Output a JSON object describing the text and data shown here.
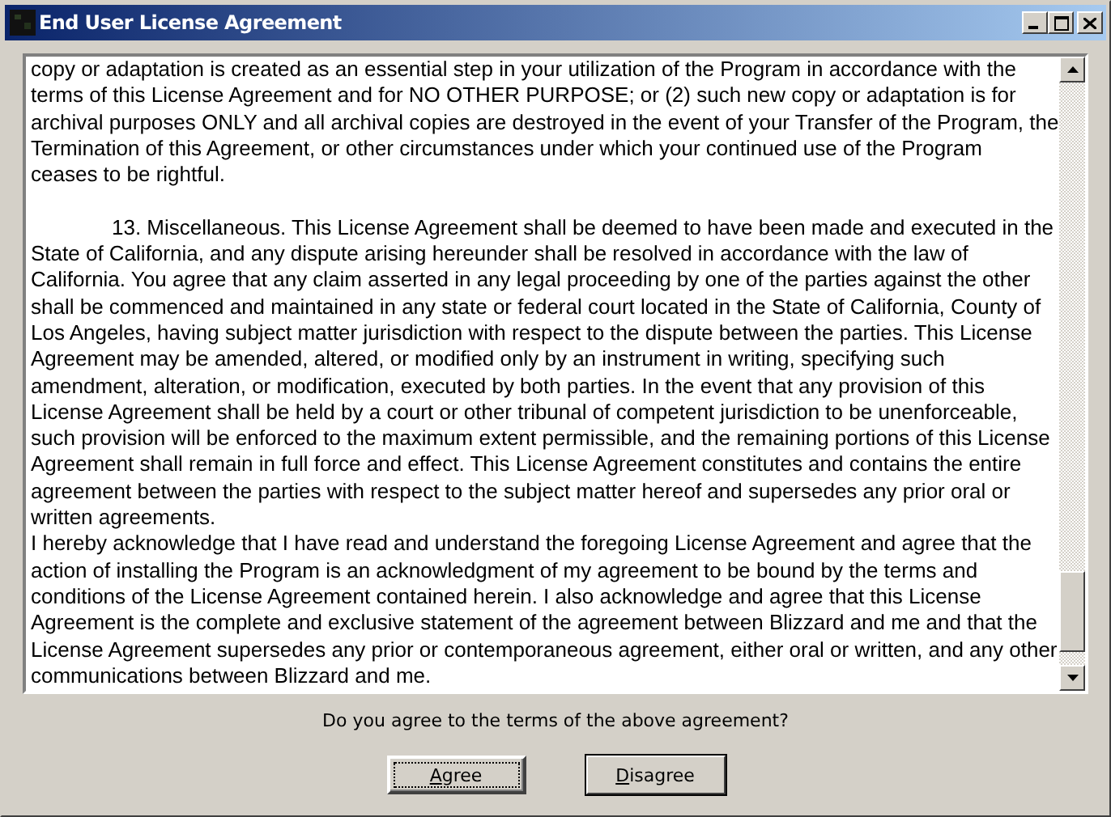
{
  "window": {
    "title": "End User License Agreement"
  },
  "license_text": {
    "paragraphs": [
      {
        "indented": false,
        "text": "copy or adaptation is created as an essential step in your utilization of the Program in accordance with the\nterms of this License Agreement and for NO OTHER PURPOSE; or (2) such new copy or adaptation is for\narchival purposes ONLY and all archival copies are destroyed in the event of your Transfer of the Program, the\nTermination of this Agreement, or other circumstances under which your continued use of the Program\nceases to be rightful."
      },
      {
        "indented": true,
        "text": "13. Miscellaneous. This License Agreement shall be deemed to have been made and executed in the\nState of California, and any dispute arising hereunder shall be resolved in accordance with the law of\nCalifornia. You agree that any claim asserted in any legal proceeding by one of the parties against the other\nshall be commenced and maintained in any state or federal court located in the State of California, County of\nLos Angeles, having subject matter jurisdiction with respect to the dispute between the parties. This License\nAgreement may be amended, altered, or modified only by an instrument in writing, specifying such\namendment, alteration, or modification, executed by both parties. In the event that any provision of this\nLicense Agreement shall be held by a court or other tribunal of competent jurisdiction to be unenforceable,\nsuch provision will be enforced to the maximum extent permissible, and the remaining portions of this License\nAgreement shall remain in full force and effect. This License Agreement constitutes and contains the entire\nagreement between the parties with respect to the subject matter hereof and supersedes any prior oral or\nwritten agreements."
      },
      {
        "indented": false,
        "text": "I hereby acknowledge that I have read and understand the foregoing License Agreement and agree that the\naction of installing the Program is an acknowledgment of my agreement to be bound by the terms and\nconditions of the License Agreement contained herein. I also acknowledge and agree that this License\nAgreement is the complete and exclusive statement of the agreement between Blizzard and me and that the\nLicense Agreement supersedes any prior or contemporaneous agreement, either oral or written, and any other\ncommunications between Blizzard and me."
      }
    ]
  },
  "question": "Do you agree to the terms of the above agreement?",
  "buttons": [
    {
      "label": "Agree",
      "focused": true
    },
    {
      "label": "Disagree",
      "focused": false
    }
  ]
}
